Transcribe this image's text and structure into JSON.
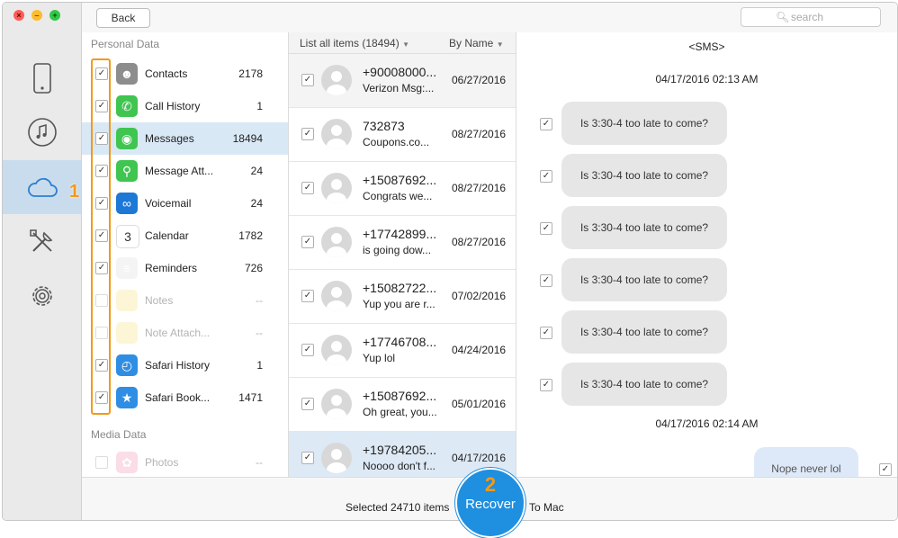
{
  "toolbar": {
    "back_label": "Back",
    "search_placeholder": "search"
  },
  "window_controls": {
    "close": "×",
    "minimize": "–",
    "zoom": "+"
  },
  "rail": {
    "items": [
      {
        "icon": "iphone-icon",
        "active": false
      },
      {
        "icon": "music-note-icon",
        "active": false
      },
      {
        "icon": "cloud-icon",
        "active": true
      },
      {
        "icon": "tools-icon",
        "active": false
      },
      {
        "icon": "gear-icon",
        "active": false
      }
    ],
    "step_badge": "1"
  },
  "categories": {
    "personal_title": "Personal Data",
    "media_title": "Media Data",
    "items": [
      {
        "label": "Contacts",
        "count": "2178",
        "checked": true,
        "enabled": true,
        "icon": "contacts-icon"
      },
      {
        "label": "Call History",
        "count": "1",
        "checked": true,
        "enabled": true,
        "icon": "phone-icon"
      },
      {
        "label": "Messages",
        "count": "18494",
        "checked": true,
        "enabled": true,
        "icon": "messages-icon"
      },
      {
        "label": "Message Att...",
        "count": "24",
        "checked": true,
        "enabled": true,
        "icon": "message-attachment-icon"
      },
      {
        "label": "Voicemail",
        "count": "24",
        "checked": true,
        "enabled": true,
        "icon": "voicemail-icon"
      },
      {
        "label": "Calendar",
        "count": "1782",
        "checked": true,
        "enabled": true,
        "icon": "calendar-icon",
        "icon_text": "3"
      },
      {
        "label": "Reminders",
        "count": "726",
        "checked": true,
        "enabled": true,
        "icon": "reminders-icon"
      },
      {
        "label": "Notes",
        "count": "--",
        "checked": false,
        "enabled": false,
        "icon": "notes-icon"
      },
      {
        "label": "Note Attach...",
        "count": "--",
        "checked": false,
        "enabled": false,
        "icon": "note-attachment-icon"
      },
      {
        "label": "Safari History",
        "count": "1",
        "checked": true,
        "enabled": true,
        "icon": "safari-history-icon"
      },
      {
        "label": "Safari Book...",
        "count": "1471",
        "checked": true,
        "enabled": true,
        "icon": "safari-bookmark-icon"
      }
    ],
    "media_items": [
      {
        "label": "Photos",
        "count": "--",
        "checked": false,
        "enabled": false,
        "icon": "photos-icon"
      }
    ]
  },
  "list": {
    "filter_label": "List all items (18494)",
    "sort_label": "By Name",
    "rows": [
      {
        "title": "+90008000...",
        "subtitle": "Verizon Msg:...",
        "date": "06/27/2016"
      },
      {
        "title": "732873",
        "subtitle": "Coupons.co...",
        "date": "08/27/2016"
      },
      {
        "title": "+15087692...",
        "subtitle": "Congrats we...",
        "date": "08/27/2016"
      },
      {
        "title": "+17742899...",
        "subtitle": " is going dow...",
        "date": "08/27/2016"
      },
      {
        "title": "+15082722...",
        "subtitle": "Yup you are r...",
        "date": "07/02/2016"
      },
      {
        "title": "+17746708...",
        "subtitle": "Yup lol",
        "date": "04/24/2016"
      },
      {
        "title": "+15087692...",
        "subtitle": "Oh great, you...",
        "date": "05/01/2016"
      },
      {
        "title": "+19784205...",
        "subtitle": "Noooo don't f...",
        "date": "04/17/2016"
      }
    ]
  },
  "detail": {
    "header": "<SMS>",
    "timestamp1": "04/17/2016 02:13 AM",
    "incoming": [
      "Is 3:30-4 too late to come?",
      "Is 3:30-4 too late to come?",
      "Is 3:30-4 too late to come?",
      "Is 3:30-4 too late to come?",
      "Is 3:30-4 too late to come?",
      "Is 3:30-4 too late to come?"
    ],
    "timestamp2": "04/17/2016 02:14 AM",
    "outgoing": "Nope never lol"
  },
  "bottom": {
    "selected_text": "Selected 24710 items",
    "recover_step": "2",
    "recover_label": "Recover",
    "to_mac": "To Mac"
  },
  "colors": {
    "accent": "#1f8fe0",
    "highlight": "#f19a1b",
    "selection": "#d9e8f5"
  }
}
